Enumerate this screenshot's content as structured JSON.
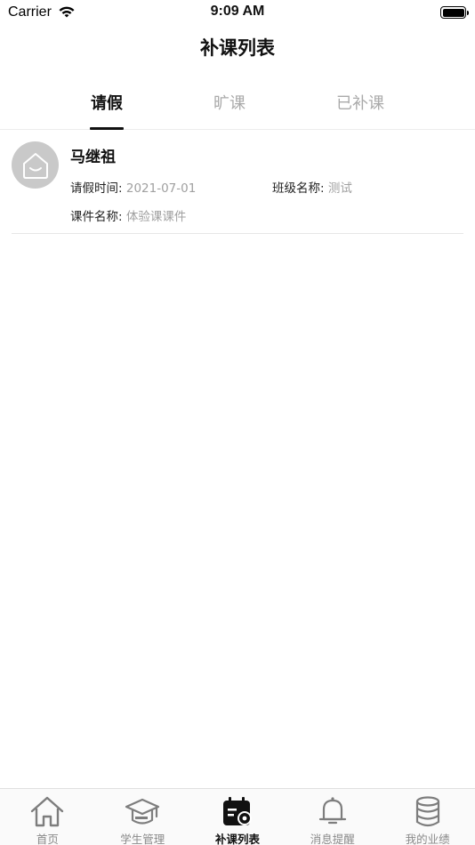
{
  "status_bar": {
    "carrier": "Carrier",
    "time": "9:09 AM"
  },
  "nav": {
    "title": "补课列表"
  },
  "tabs": [
    {
      "label": "请假",
      "active": true
    },
    {
      "label": "旷课",
      "active": false
    },
    {
      "label": "已补课",
      "active": false
    }
  ],
  "records": [
    {
      "name": "马继祖",
      "leave_time_label": "请假时间:",
      "leave_time_value": "2021-07-01",
      "class_name_label": "班级名称:",
      "class_name_value": "测试",
      "course_label": "课件名称:",
      "course_value": "体验课课件",
      "avatar_icon": "default-avatar-icon"
    }
  ],
  "tab_bar": [
    {
      "label": "首页",
      "icon": "home-icon",
      "active": false
    },
    {
      "label": "学生管理",
      "icon": "graduation-cap-icon",
      "active": false
    },
    {
      "label": "补课列表",
      "icon": "calendar-list-icon",
      "active": true
    },
    {
      "label": "消息提醒",
      "icon": "bell-icon",
      "active": false
    },
    {
      "label": "我的业绩",
      "icon": "database-stack-icon",
      "active": false
    }
  ],
  "colors": {
    "active_text": "#111111",
    "inactive_text": "#8a8a8a",
    "value_text": "#a0a0a0",
    "avatar_bg": "#c9c9c9"
  }
}
